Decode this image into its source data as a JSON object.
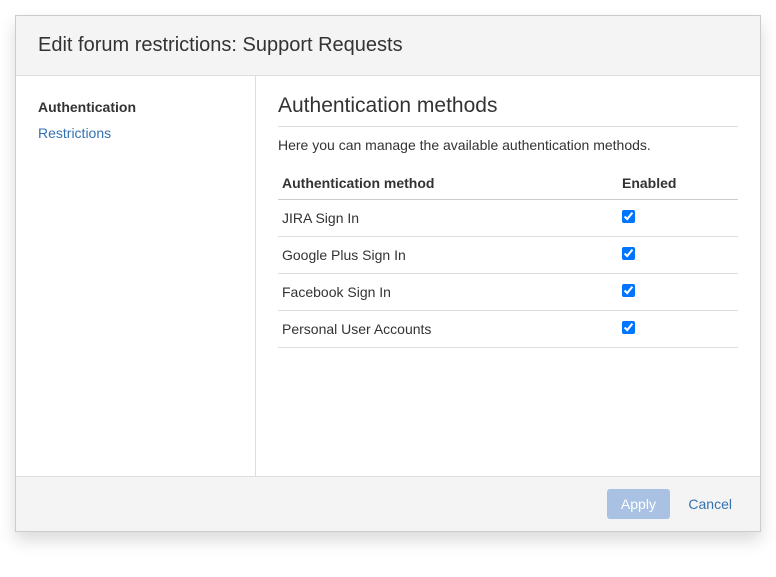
{
  "header": {
    "title": "Edit forum restrictions: Support Requests"
  },
  "sidebar": {
    "items": [
      {
        "label": "Authentication",
        "active": true
      },
      {
        "label": "Restrictions",
        "active": false
      }
    ]
  },
  "main": {
    "title": "Authentication methods",
    "description": "Here you can manage the available authentication methods.",
    "table": {
      "columns": [
        "Authentication method",
        "Enabled"
      ],
      "rows": [
        {
          "name": "JIRA Sign In",
          "enabled": true
        },
        {
          "name": "Google Plus Sign In",
          "enabled": true
        },
        {
          "name": "Facebook Sign In",
          "enabled": true
        },
        {
          "name": "Personal User Accounts",
          "enabled": true
        }
      ]
    }
  },
  "footer": {
    "apply": "Apply",
    "cancel": "Cancel"
  }
}
